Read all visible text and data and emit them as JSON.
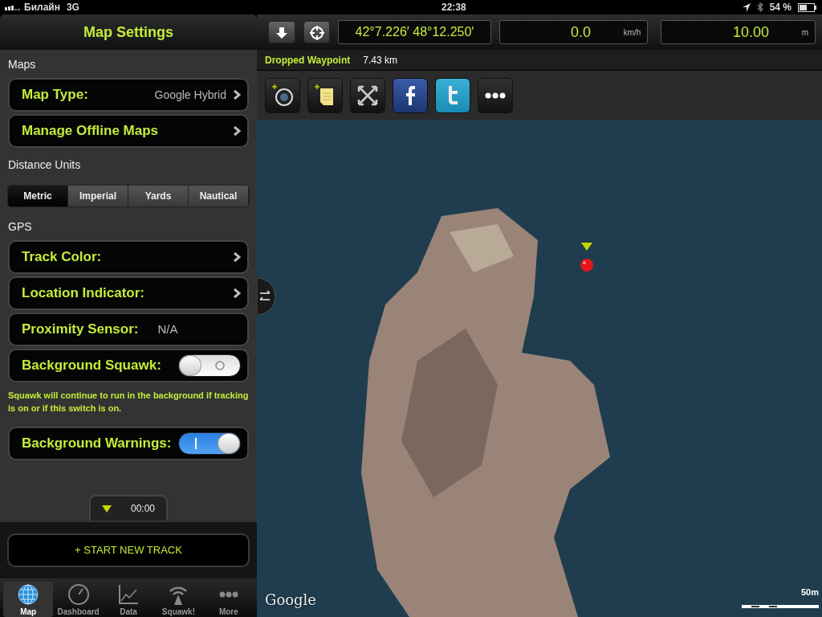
{
  "status_bar": {
    "carrier": "Билайн",
    "network": "3G",
    "time": "22:38",
    "battery": "54 %"
  },
  "settings": {
    "title": "Map Settings",
    "sections": [
      {
        "header": "Maps",
        "rows": [
          {
            "kind": "nav",
            "label": "Map Type:",
            "value": "Google Hybrid"
          },
          {
            "kind": "nav",
            "label": "Manage Offline Maps"
          }
        ]
      },
      {
        "header": "Distance Units",
        "segments": [
          {
            "label": "Metric",
            "selected": true
          },
          {
            "label": "Imperial",
            "selected": false
          },
          {
            "label": "Yards",
            "selected": false
          },
          {
            "label": "Nautical",
            "selected": false
          }
        ]
      },
      {
        "header": "GPS",
        "rows": [
          {
            "kind": "nav",
            "label": "Track Color:"
          },
          {
            "kind": "nav",
            "label": "Location Indicator:"
          },
          {
            "kind": "info",
            "label": "Proximity Sensor:",
            "value": "N/A"
          },
          {
            "kind": "switch",
            "label": "Background Squawk:",
            "on": false
          },
          {
            "kind": "note",
            "text": "Squawk will continue to run in the background if tracking is on or if this switch is on."
          },
          {
            "kind": "switch",
            "label": "Background Warnings:",
            "on": true
          }
        ]
      }
    ]
  },
  "tracker": {
    "timer": "00:00",
    "start_button": "+ START NEW TRACK"
  },
  "tab_bar": [
    {
      "label": "Map",
      "selected": true
    },
    {
      "label": "Dashboard",
      "selected": false
    },
    {
      "label": "Data",
      "selected": false
    },
    {
      "label": "Squawk!",
      "selected": false
    },
    {
      "label": "More",
      "selected": false
    }
  ],
  "toolbar": {
    "coordinates": "42°7.226′ 48°12.250′",
    "readouts": [
      {
        "value": "0.0",
        "unit": "km/h"
      },
      {
        "value": "10.00",
        "unit": "m"
      }
    ]
  },
  "waypoint": {
    "name": "Dropped Waypoint",
    "distance": "7.43 km"
  },
  "actions": [
    {
      "kind": "camera"
    },
    {
      "kind": "note"
    },
    {
      "kind": "expand"
    },
    {
      "kind": "facebook"
    },
    {
      "kind": "twitter"
    },
    {
      "kind": "more"
    }
  ],
  "map": {
    "attribution": "Google",
    "scale": "50m"
  }
}
